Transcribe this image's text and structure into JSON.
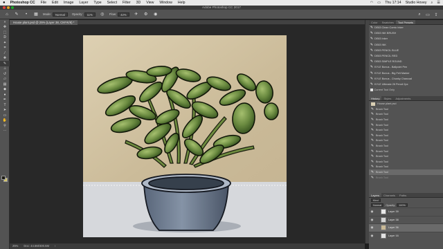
{
  "menubar": {
    "apple": "",
    "app": "Photoshop CC",
    "items": [
      "File",
      "Edit",
      "Image",
      "Layer",
      "Type",
      "Select",
      "Filter",
      "3D",
      "View",
      "Window",
      "Help"
    ],
    "clock": "Thu 17:14",
    "user": "Studio Hovey"
  },
  "window": {
    "title": "Adobe Photoshop CC 2017"
  },
  "options": {
    "mode_label": "Mode:",
    "mode_value": "Normal",
    "opacity_label": "Opacity:",
    "opacity_value": "11%",
    "flow_label": "Flow:",
    "flow_value": "42%"
  },
  "document": {
    "tab": "House plant.psd @ 25% (Layer 38, CMYK/8) *",
    "status_zoom": "25%",
    "status_doc": "Doc: 44.6M/400.5M"
  },
  "tool_presets": {
    "tabs": [
      "Color",
      "Swatches",
      "Tool Presets"
    ],
    "active_tab": "Tool Presets",
    "items": [
      "DE83 Clean Comic Inker",
      "DE83 INK BRUSH",
      "DE83 Inker",
      "DE83 INK",
      "DE83 PENCIL BLUE",
      "DE83 PENCIL RED",
      "DE83 SIMPLE ROUND",
      "KYLE Bonus - Ballpoint Pen",
      "KYLE Bonus - Big Felt Marker",
      "KYLE Bonus - Chunky Charcoal",
      "KYLE Ultimate 26 Pencil 2px"
    ],
    "current_tool_only": "Current Tool Only"
  },
  "history": {
    "tabs": [
      "History",
      "Styles",
      "Adjustments"
    ],
    "active_tab": "History",
    "snapshot": "House plant.psd",
    "items": [
      "Brush Tool",
      "Brush Tool",
      "Brush Tool",
      "Brush Tool",
      "Brush Tool",
      "Brush Tool",
      "Brush Tool",
      "Brush Tool",
      "Brush Tool",
      "Brush Tool",
      "Brush Tool",
      "Brush Tool",
      "Brush Tool",
      "Brush Tool"
    ],
    "selected_index": 12
  },
  "layers": {
    "tabs": [
      "Layers",
      "Channels",
      "Paths"
    ],
    "active_tab": "Layers",
    "kind_label": "Kind",
    "blend": "Normal",
    "opacity_label": "Opacity:",
    "opacity_value": "100%",
    "lock_label": "Lock:",
    "fill_label": "Fill:",
    "fill_value": "100%",
    "items": [
      "Layer 39",
      "Layer 38",
      "Layer 36",
      "Layer 16",
      "Layer 35"
    ],
    "selected_index": 2
  },
  "colors": {
    "foreground": "#1b1a12",
    "background": "#d4c56a",
    "wall": "#cfc1a0",
    "pot": "#6f7d91",
    "leaf": "#5f7f3c"
  }
}
